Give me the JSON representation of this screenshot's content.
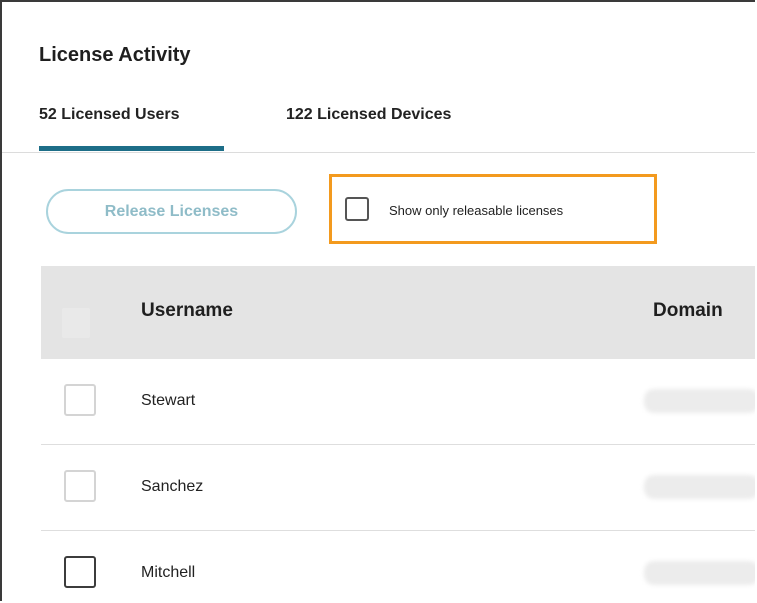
{
  "panel": {
    "title": "License Activity"
  },
  "tabs": [
    {
      "label": "52 Licensed Users",
      "selected": true
    },
    {
      "label": "122 Licensed Devices",
      "selected": false
    }
  ],
  "toolbar": {
    "release_label": "Release Licenses",
    "release_enabled": false,
    "filter_label": "Show only releasable licenses",
    "filter_checked": false,
    "highlight_color": "#f39a1e"
  },
  "table": {
    "columns": [
      "Username",
      "Domain"
    ],
    "rows": [
      {
        "username": "Stewart",
        "domain_obscured": true
      },
      {
        "username": "Sanchez",
        "domain_obscured": true
      },
      {
        "username": "Mitchell",
        "domain_obscured": true
      }
    ]
  },
  "colors": {
    "accent": "#1d6e88",
    "disabled_button_border": "#a9d3dd",
    "header_background": "#e4e4e4"
  }
}
